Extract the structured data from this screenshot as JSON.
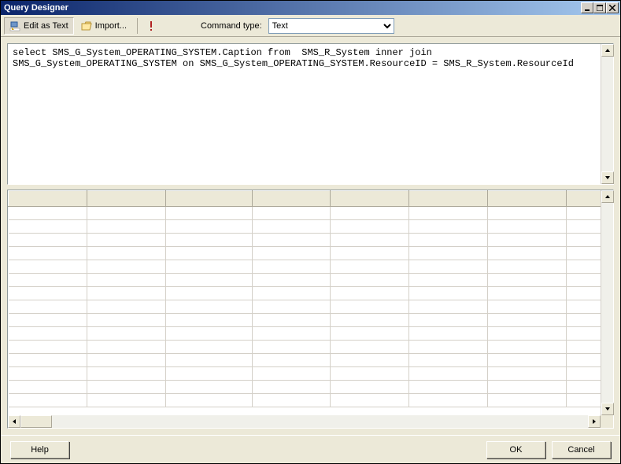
{
  "window": {
    "title": "Query Designer"
  },
  "toolbar": {
    "edit_as_text": "Edit as Text",
    "import": "Import...",
    "command_type_label": "Command type:",
    "command_type_value": "Text"
  },
  "query": {
    "text": "select SMS_G_System_OPERATING_SYSTEM.Caption from  SMS_R_System inner join SMS_G_System_OPERATING_SYSTEM on SMS_G_System_OPERATING_SYSTEM.ResourceID = SMS_R_System.ResourceId"
  },
  "results": {
    "columns": [
      "",
      "",
      "",
      "",
      "",
      "",
      "",
      ""
    ],
    "rows": [
      [
        "",
        "",
        "",
        "",
        "",
        "",
        "",
        ""
      ],
      [
        "",
        "",
        "",
        "",
        "",
        "",
        "",
        ""
      ],
      [
        "",
        "",
        "",
        "",
        "",
        "",
        "",
        ""
      ],
      [
        "",
        "",
        "",
        "",
        "",
        "",
        "",
        ""
      ],
      [
        "",
        "",
        "",
        "",
        "",
        "",
        "",
        ""
      ],
      [
        "",
        "",
        "",
        "",
        "",
        "",
        "",
        ""
      ],
      [
        "",
        "",
        "",
        "",
        "",
        "",
        "",
        ""
      ],
      [
        "",
        "",
        "",
        "",
        "",
        "",
        "",
        ""
      ],
      [
        "",
        "",
        "",
        "",
        "",
        "",
        "",
        ""
      ],
      [
        "",
        "",
        "",
        "",
        "",
        "",
        "",
        ""
      ],
      [
        "",
        "",
        "",
        "",
        "",
        "",
        "",
        ""
      ],
      [
        "",
        "",
        "",
        "",
        "",
        "",
        "",
        ""
      ],
      [
        "",
        "",
        "",
        "",
        "",
        "",
        "",
        ""
      ],
      [
        "",
        "",
        "",
        "",
        "",
        "",
        "",
        ""
      ],
      [
        "",
        "",
        "",
        "",
        "",
        "",
        "",
        ""
      ]
    ]
  },
  "buttons": {
    "help": "Help",
    "ok": "OK",
    "cancel": "Cancel"
  }
}
